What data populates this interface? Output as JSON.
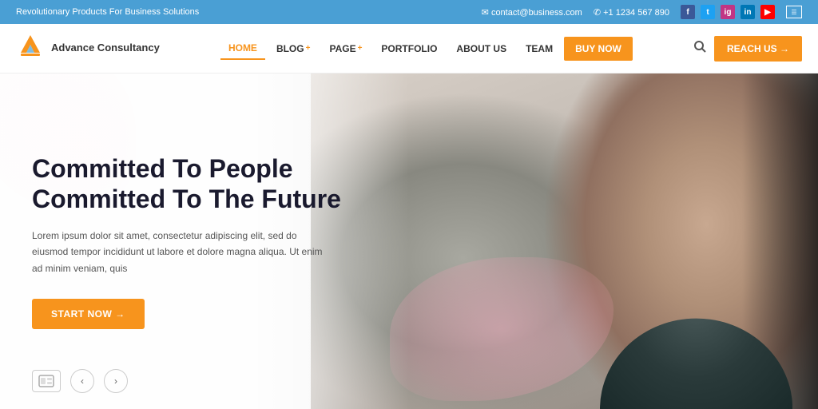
{
  "topbar": {
    "tagline": "Revolutionary Products For Business Solutions",
    "email_icon": "✉",
    "email": "contact@business.com",
    "phone_icon": "✆",
    "phone": "+1 1234 567 890",
    "social": [
      {
        "name": "facebook",
        "label": "f"
      },
      {
        "name": "twitter",
        "label": "t"
      },
      {
        "name": "instagram",
        "label": "ig"
      },
      {
        "name": "linkedin",
        "label": "in"
      },
      {
        "name": "youtube",
        "label": "▶"
      }
    ]
  },
  "header": {
    "logo_name": "Advance Consultancy",
    "nav": [
      {
        "id": "home",
        "label": "HOME",
        "active": true,
        "hasPlus": false
      },
      {
        "id": "blog",
        "label": "BLOG",
        "active": false,
        "hasPlus": true
      },
      {
        "id": "page",
        "label": "PAGE",
        "active": false,
        "hasPlus": true
      },
      {
        "id": "portfolio",
        "label": "PORTFOLIO",
        "active": false,
        "hasPlus": false
      },
      {
        "id": "about",
        "label": "ABOUT US",
        "active": false,
        "hasPlus": false
      },
      {
        "id": "team",
        "label": "TEAM",
        "active": false,
        "hasPlus": false
      }
    ],
    "buy_btn": "BUY NOW",
    "reach_btn": "REACH US →",
    "search_placeholder": "Search..."
  },
  "hero": {
    "title_line1": "Committed To People",
    "title_line2": "Committed To The Future",
    "subtitle": "Lorem ipsum dolor sit amet, consectetur adipiscing elit, sed do eiusmod tempor incididunt ut labore et dolore magna aliqua. Ut enim ad minim veniam, quis",
    "cta_btn": "START NOW →",
    "slide_prev": "‹",
    "slide_next": "›",
    "slide_icon": "▤"
  },
  "colors": {
    "orange": "#f7941d",
    "topbar_blue": "#4a9fd4",
    "nav_active": "#f7941d",
    "text_dark": "#1a1a2e",
    "text_light": "#555555"
  }
}
